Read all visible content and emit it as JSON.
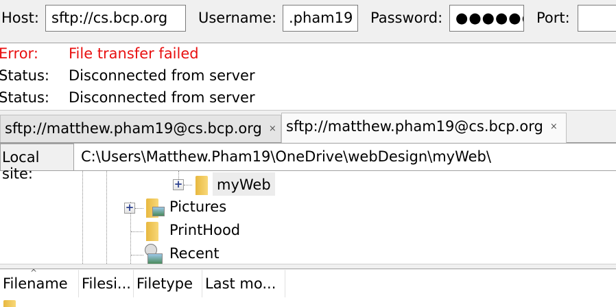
{
  "quickconnect": {
    "host_label": "Host:",
    "host_value": "sftp://cs.bcp.org",
    "username_label": "Username:",
    "username_value": ".pham19",
    "password_label": "Password:",
    "password_value": "●●●●●●",
    "port_label": "Port:",
    "port_value": ""
  },
  "log": [
    {
      "kind": "Error:",
      "text": "File transfer failed",
      "type": "error"
    },
    {
      "kind": "Status:",
      "text": "Disconnected from server",
      "type": "status"
    },
    {
      "kind": "Status:",
      "text": "Disconnected from server",
      "type": "status"
    }
  ],
  "tabs": [
    {
      "label": "sftp://matthew.pham19@cs.bcp.org",
      "close": "×"
    },
    {
      "label": "sftp://matthew.pham19@cs.bcp.org",
      "close": "×"
    }
  ],
  "local_site": {
    "label": "Local site:",
    "path": "C:\\Users\\Matthew.Pham19\\OneDrive\\webDesign\\myWeb\\"
  },
  "tree": [
    {
      "name": "myWeb",
      "expand": "+"
    },
    {
      "name": "Pictures",
      "expand": "+"
    },
    {
      "name": "PrintHood"
    },
    {
      "name": "Recent"
    }
  ],
  "file_list": {
    "columns": [
      "Filename",
      "Filesi...",
      "Filetype",
      "Last mo..."
    ],
    "sort_indicator": "^"
  }
}
